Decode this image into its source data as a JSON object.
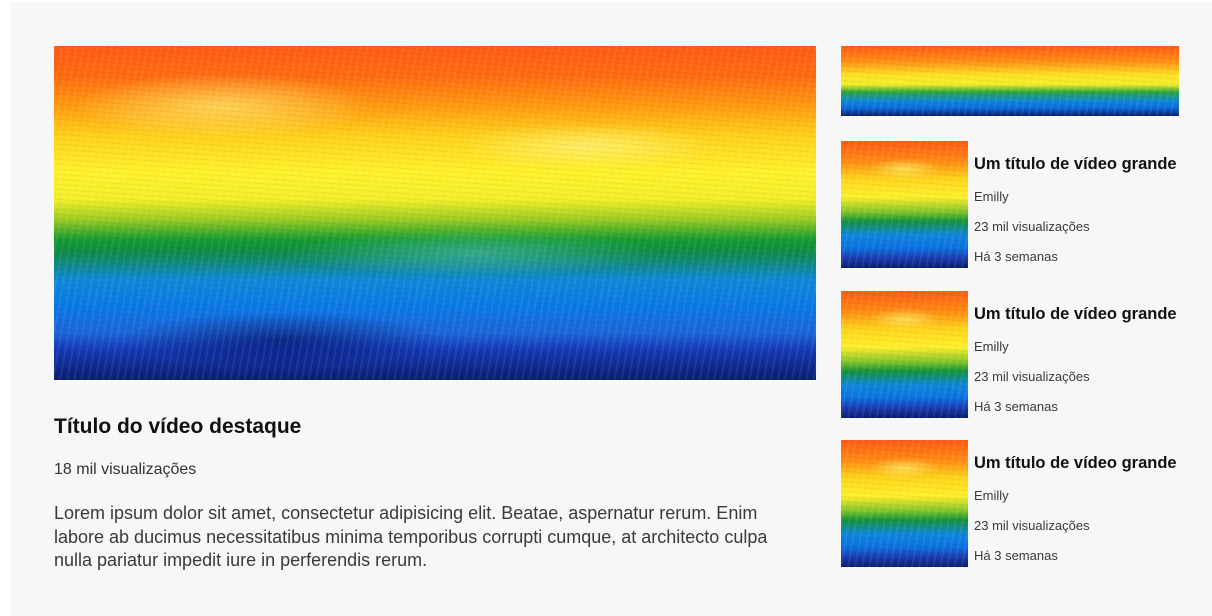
{
  "featured": {
    "title": "Título do vídeo destaque",
    "views": "18 mil visualizações",
    "description": "Lorem ipsum dolor sit amet, consectetur adipisicing elit. Beatae, aspernatur rerum. Enim labore ab ducimus necessitatibus minima temporibus corrupti cumque, at architecto culpa nulla pariatur impedit iure in perferendis rerum."
  },
  "sidebar": {
    "videos": [
      {
        "title": "Um título de vídeo grande",
        "author": "Emilly",
        "views": "23 mil visualizações",
        "date": "Há 3 semanas"
      },
      {
        "title": "Um título de vídeo grande",
        "author": "Emilly",
        "views": "23 mil visualizações",
        "date": "Há 3 semanas"
      },
      {
        "title": "Um título de vídeo grande",
        "author": "Emilly",
        "views": "23 mil visualizações",
        "date": "Há 3 semanas"
      }
    ]
  },
  "colors": {
    "background": "#f7f7f7",
    "title": "#111111",
    "text": "#3a3a3a"
  }
}
